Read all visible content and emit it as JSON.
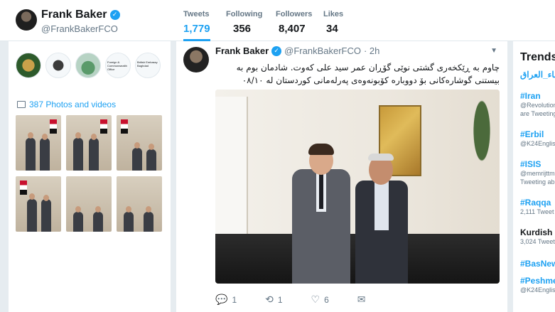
{
  "profile": {
    "name": "Frank Baker",
    "handle": "@FrankBakerFCO"
  },
  "stats": [
    {
      "label": "Tweets",
      "value": "1,779"
    },
    {
      "label": "Following",
      "value": "356"
    },
    {
      "label": "Followers",
      "value": "8,407"
    },
    {
      "label": "Likes",
      "value": "34"
    }
  ],
  "sidebar": {
    "photos_label": "387 Photos and videos",
    "logo_texts": [
      "Foreign & Commonwealth Office",
      "British Embassy Baghdad"
    ]
  },
  "tweet": {
    "name": "Frank Baker",
    "handle": "@FrankBakerFCO",
    "time": "· 2h",
    "text": "چاوم به ڕێکخەری گشتی نوێی گۆڕان عمر سید علی کەوت. شادمان بوم بە بیستنی گوشارەکانی بۆ دووبارە کۆبونەوەی پەرلەمانی کوردستان لە ٠٨/١٠",
    "replies": "1",
    "retweets": "1",
    "likes": "6"
  },
  "trends": {
    "title": "Trends",
    "items": [
      {
        "tag": "علماء_العراق_",
        "sub": ""
      },
      {
        "tag": "#Iran",
        "sub": "@Revolution",
        "sub2": "are Tweeting"
      },
      {
        "tag": "#Erbil",
        "sub": "@K24Englis"
      },
      {
        "tag": "#ISIS",
        "sub": "@memrijttm",
        "sub2": "Tweeting ab"
      },
      {
        "tag": "#Raqqa",
        "sub": "2,111 Tweet"
      },
      {
        "tag": "Kurdish",
        "sub": "3,024 Tweet"
      },
      {
        "tag": "#BasNews",
        "sub": ""
      },
      {
        "tag": "#Peshmer",
        "sub": "@K24Englis"
      }
    ]
  },
  "colors": {
    "accent": "#1da1f2",
    "background": "#e6ecf0"
  }
}
